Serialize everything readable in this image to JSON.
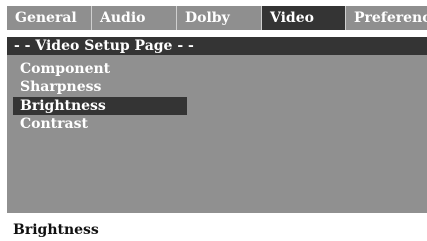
{
  "tabs": [
    {
      "label": "General",
      "active": false
    },
    {
      "label": "Audio",
      "active": false
    },
    {
      "label": "Dolby",
      "active": false
    },
    {
      "label": "Video",
      "active": true
    },
    {
      "label": "Preference",
      "active": false
    }
  ],
  "page_header": "- - Video Setup Page - -",
  "menu": [
    {
      "label": "Component",
      "selected": false
    },
    {
      "label": "Sharpness",
      "selected": false
    },
    {
      "label": "Brightness",
      "selected": true
    },
    {
      "label": "Contrast",
      "selected": false
    }
  ],
  "status": "Brightness",
  "colors": {
    "panel": "#909090",
    "highlight": "#343434",
    "text_light": "#ffffff",
    "text_dark": "#111111"
  }
}
